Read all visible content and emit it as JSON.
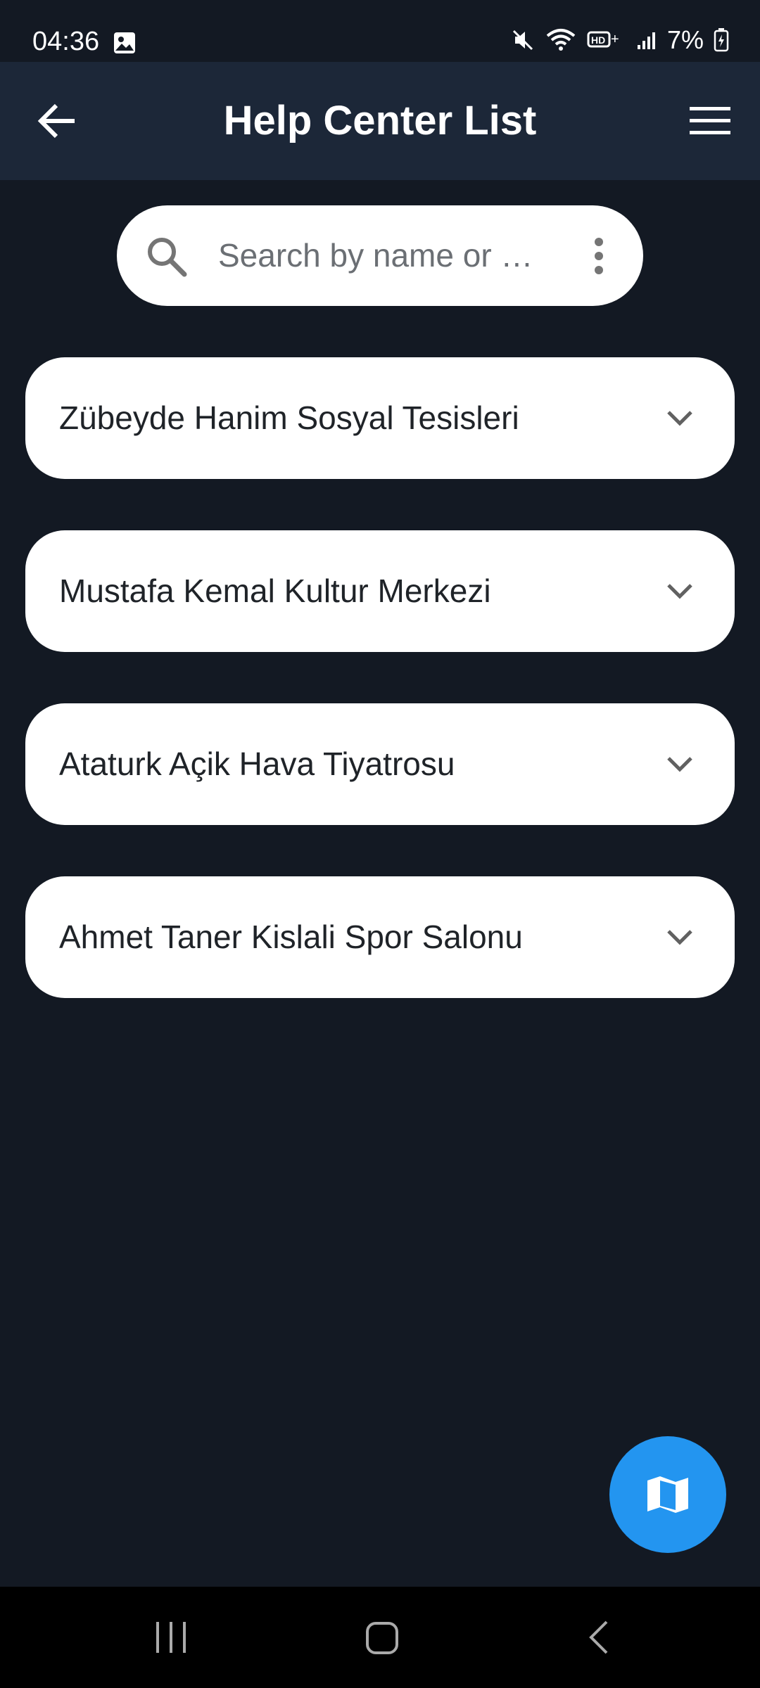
{
  "status_bar": {
    "time": "04:36",
    "battery": "7%",
    "icons": [
      "image-icon",
      "mute-icon",
      "wifi-icon",
      "hd-voice-icon",
      "signal-icon",
      "battery-charging-icon"
    ]
  },
  "app_bar": {
    "title": "Help Center List",
    "back_icon": "arrow-left-icon",
    "menu_icon": "hamburger-menu-icon"
  },
  "search": {
    "placeholder": "Search by name or …",
    "value": "",
    "icon": "search-icon",
    "options_icon": "more-vertical-icon"
  },
  "help_centers": [
    {
      "label": "Zübeyde Hanim Sosyal Tesisleri"
    },
    {
      "label": "Mustafa Kemal Kultur Merkezi"
    },
    {
      "label": "Ataturk Açik Hava Tiyatrosu"
    },
    {
      "label": "Ahmet Taner Kislali Spor Salonu"
    }
  ],
  "fab": {
    "icon": "map-icon"
  },
  "nav_bar": {
    "icons": [
      "recent-apps-icon",
      "home-icon",
      "back-icon"
    ]
  },
  "colors": {
    "background": "#131923",
    "app_bar": "#1c2738",
    "card": "#ffffff",
    "fab": "#2395f0"
  }
}
